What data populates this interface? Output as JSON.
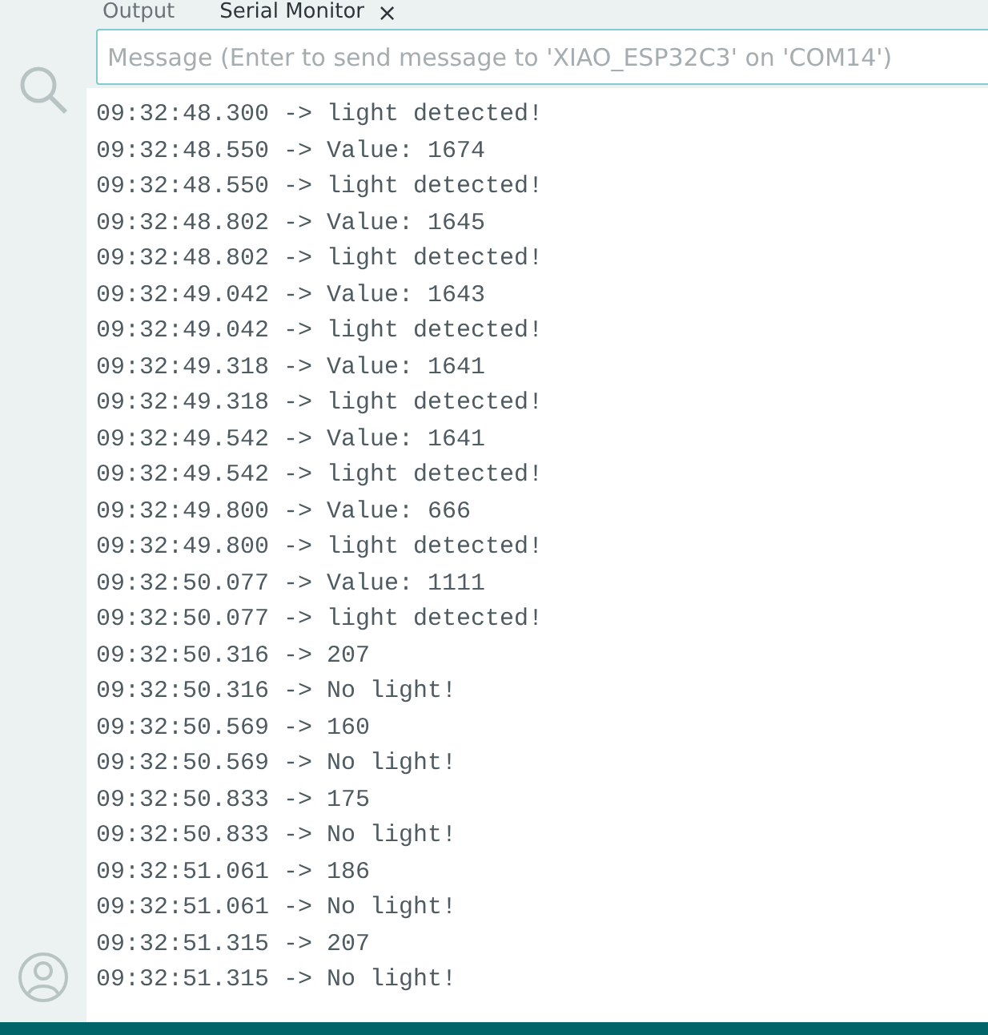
{
  "tabs": [
    {
      "label": "Output",
      "selected": false,
      "closable": false
    },
    {
      "label": "Serial Monitor",
      "selected": true,
      "closable": true
    }
  ],
  "close_glyph": "×",
  "message_field": {
    "placeholder": "Message (Enter to send message to 'XIAO_ESP32C3' on 'COM14')"
  },
  "log_lines": [
    "09:32:48.300 -> light detected!",
    "09:32:48.550 -> Value: 1674",
    "09:32:48.550 -> light detected!",
    "09:32:48.802 -> Value: 1645",
    "09:32:48.802 -> light detected!",
    "09:32:49.042 -> Value: 1643",
    "09:32:49.042 -> light detected!",
    "09:32:49.318 -> Value: 1641",
    "09:32:49.318 -> light detected!",
    "09:32:49.542 -> Value: 1641",
    "09:32:49.542 -> light detected!",
    "09:32:49.800 -> Value: 666",
    "09:32:49.800 -> light detected!",
    "09:32:50.077 -> Value: 1111",
    "09:32:50.077 -> light detected!",
    "09:32:50.316 -> 207",
    "09:32:50.316 -> No light!",
    "09:32:50.569 -> 160",
    "09:32:50.569 -> No light!",
    "09:32:50.833 -> 175",
    "09:32:50.833 -> No light!",
    "09:32:51.061 -> 186",
    "09:32:51.061 -> No light!",
    "09:32:51.315 -> 207",
    "09:32:51.315 -> No light!"
  ]
}
